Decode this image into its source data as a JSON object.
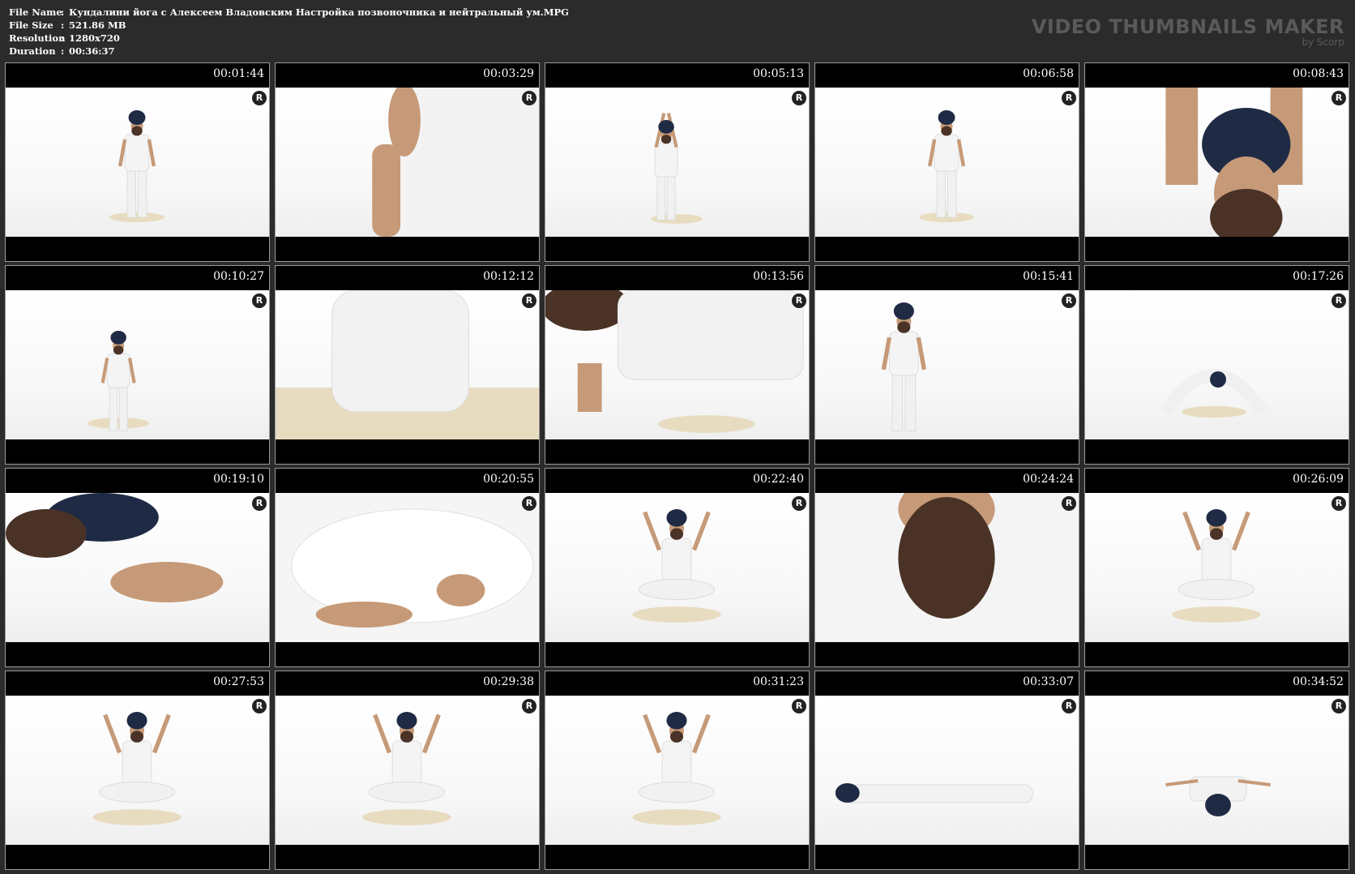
{
  "info": [
    {
      "key": "File Name",
      "value": "Кундалини йога с Алексеем Владовским Настройка позвоночника и нейтральный ум.MPG"
    },
    {
      "key": "File Size",
      "value": "521.86 MB"
    },
    {
      "key": "Resolution",
      "value": "1280x720"
    },
    {
      "key": "Duration",
      "value": "00:36:37"
    }
  ],
  "brand": {
    "title": "VIDEO THUMBNAILS MAKER",
    "subtitle": "by Scorp"
  },
  "watermark_glyph": "R",
  "thumbnails": [
    {
      "time": "00:01:44",
      "scene": "tree-pose-full"
    },
    {
      "time": "00:03:29",
      "scene": "hands-prayer-closeup"
    },
    {
      "time": "00:05:13",
      "scene": "tree-pose-arms-up"
    },
    {
      "time": "00:06:58",
      "scene": "tree-pose-full"
    },
    {
      "time": "00:08:43",
      "scene": "arms-up-closeup"
    },
    {
      "time": "00:10:27",
      "scene": "squat-hands-head"
    },
    {
      "time": "00:12:12",
      "scene": "crouch-closeup"
    },
    {
      "time": "00:13:56",
      "scene": "bend-hands-floor"
    },
    {
      "time": "00:15:41",
      "scene": "standing"
    },
    {
      "time": "00:17:26",
      "scene": "forward-fold"
    },
    {
      "time": "00:19:10",
      "scene": "foot-closeup"
    },
    {
      "time": "00:20:55",
      "scene": "legs-closeup"
    },
    {
      "time": "00:22:40",
      "scene": "seated-fingers-up"
    },
    {
      "time": "00:24:24",
      "scene": "beard-closeup"
    },
    {
      "time": "00:26:09",
      "scene": "seated-fingers-up"
    },
    {
      "time": "00:27:53",
      "scene": "seated-fingers-up"
    },
    {
      "time": "00:29:38",
      "scene": "seated-fingers-up"
    },
    {
      "time": "00:31:23",
      "scene": "seated-fingers-up"
    },
    {
      "time": "00:33:07",
      "scene": "lying-side"
    },
    {
      "time": "00:34:52",
      "scene": "lying-star"
    }
  ]
}
